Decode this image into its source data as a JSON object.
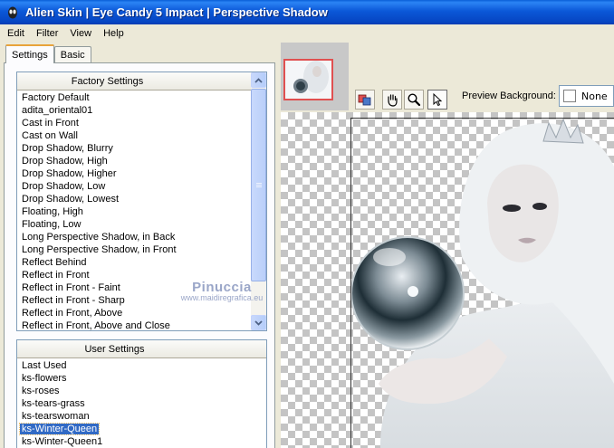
{
  "window": {
    "title": "Alien Skin  |  Eye Candy 5 Impact  |  Perspective Shadow",
    "titlebar_color": "#0a53d6"
  },
  "menu": [
    "Edit",
    "Filter",
    "View",
    "Help"
  ],
  "tabs": [
    "Settings",
    "Basic"
  ],
  "factory_settings": {
    "header": "Factory Settings",
    "items": [
      "Factory Default",
      "adita_oriental01",
      "Cast in Front",
      "Cast on Wall",
      "Drop Shadow, Blurry",
      "Drop Shadow, High",
      "Drop Shadow, Higher",
      "Drop Shadow, Low",
      "Drop Shadow, Lowest",
      "Floating, High",
      "Floating, Low",
      "Long Perspective Shadow, in Back",
      "Long Perspective Shadow, in Front",
      "Reflect Behind",
      "Reflect in Front",
      "Reflect in Front - Faint",
      "Reflect in Front - Sharp",
      "Reflect in Front, Above",
      "Reflect in Front, Above and Close"
    ]
  },
  "user_settings": {
    "header": "User Settings",
    "items": [
      "Last Used",
      "ks-flowers",
      "ks-roses",
      "ks-tears-grass",
      "ks-tearswoman",
      "ks-Winter-Queen",
      "ks-Winter-Queen1"
    ],
    "selected": "ks-Winter-Queen"
  },
  "preview": {
    "background_label": "Preview Background:",
    "background_value": "None",
    "tools": [
      "preview-toggle-icon",
      "hand-icon",
      "zoom-icon",
      "pointer-icon"
    ]
  },
  "watermark": {
    "line1": "Pinuccia",
    "line2": "www.maidiregrafica.eu"
  },
  "colors": {
    "selection": "#316ac5",
    "thumbnail_border": "#e05050",
    "scrollbar": "#c1d3fb"
  }
}
